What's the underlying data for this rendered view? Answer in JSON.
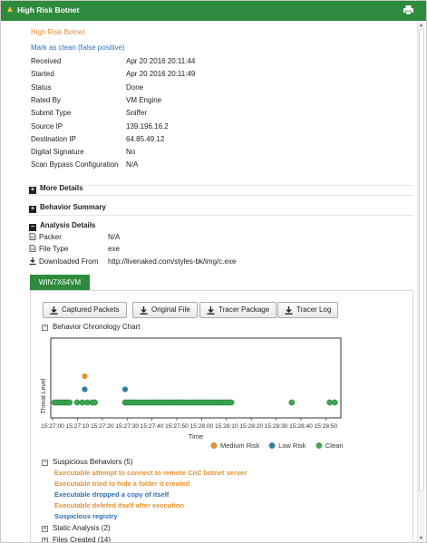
{
  "header": {
    "title": "High Risk Botnet",
    "print_icon": "print-icon",
    "warning_icon": "warning-icon"
  },
  "summary": {
    "verdict": "High Risk Botnet",
    "mark_clean": "Mark as clean (false positive)",
    "fields": [
      {
        "label": "Received",
        "value": "Apr 20 2016 20:11:44"
      },
      {
        "label": "Started",
        "value": "Apr 20 2016 20:11:49"
      },
      {
        "label": "Status",
        "value": "Done"
      },
      {
        "label": "Rated By",
        "value": "VM Engine"
      },
      {
        "label": "Submit Type",
        "value": "Sniffer"
      },
      {
        "label": "Source IP",
        "value": "139.196.16.2"
      },
      {
        "label": "Destination IP",
        "value": "64.85.49.12"
      },
      {
        "label": "Digital Signature",
        "value": "No"
      },
      {
        "label": "Scan Bypass Configuration",
        "value": "N/A"
      }
    ]
  },
  "sections": {
    "more_details": "More Details",
    "behavior_summary": "Behavior Summary",
    "analysis_details": "Analysis Details"
  },
  "analysis": {
    "packer_label": "Packer",
    "packer_value": "N/A",
    "filetype_label": "File Type",
    "filetype_value": "exe",
    "download_label": "Downloaded From",
    "download_value": "http://livenaked.com/styles-bk/img/c.exe"
  },
  "tab": {
    "label": "WIN7X64VM"
  },
  "buttons": {
    "captured": "Captured Packets",
    "original": "Original File",
    "tracer_pkg": "Tracer Package",
    "tracer_log": "Tracer Log"
  },
  "chart_section": {
    "title": "Behavior Chronology Chart"
  },
  "chart_data": {
    "type": "scatter",
    "ylabel": "Threat Level",
    "xlabel": "Time",
    "x_ticks": [
      "15:27:00",
      "15:27:10",
      "15:27:20",
      "15:27:30",
      "15:27:40",
      "15:27:50",
      "15:28:00",
      "15:28:10",
      "15:28:20",
      "15:28:30",
      "15:28:40",
      "15:28:50"
    ],
    "legend": [
      {
        "name": "Medium Risk",
        "color": "#e8912d"
      },
      {
        "name": "Low Risk",
        "color": "#2f7fa0"
      },
      {
        "name": "Clean",
        "color": "#3aa852"
      }
    ],
    "series": [
      {
        "name": "Medium Risk",
        "color": "#e8912d",
        "points": [
          [
            12,
            3
          ]
        ]
      },
      {
        "name": "Low Risk",
        "color": "#2f7fa0",
        "points": [
          [
            12,
            2
          ],
          [
            28,
            2
          ]
        ]
      },
      {
        "name": "Clean",
        "color": "#3aa852",
        "points": [
          [
            0,
            1
          ],
          [
            1,
            1
          ],
          [
            2,
            1
          ],
          [
            3,
            1
          ],
          [
            4,
            1
          ],
          [
            5,
            1
          ],
          [
            6,
            1
          ],
          [
            9,
            1
          ],
          [
            11,
            1
          ],
          [
            13,
            1
          ],
          [
            15,
            1
          ],
          [
            16,
            1
          ],
          [
            28,
            1
          ],
          [
            29,
            1
          ],
          [
            30,
            1
          ],
          [
            31,
            1
          ],
          [
            32,
            1
          ],
          [
            33,
            1
          ],
          [
            34,
            1
          ],
          [
            35,
            1
          ],
          [
            36,
            1
          ],
          [
            37,
            1
          ],
          [
            38,
            1
          ],
          [
            39,
            1
          ],
          [
            40,
            1
          ],
          [
            41,
            1
          ],
          [
            42,
            1
          ],
          [
            43,
            1
          ],
          [
            44,
            1
          ],
          [
            45,
            1
          ],
          [
            46,
            1
          ],
          [
            47,
            1
          ],
          [
            48,
            1
          ],
          [
            49,
            1
          ],
          [
            50,
            1
          ],
          [
            51,
            1
          ],
          [
            52,
            1
          ],
          [
            53,
            1
          ],
          [
            54,
            1
          ],
          [
            55,
            1
          ],
          [
            56,
            1
          ],
          [
            57,
            1
          ],
          [
            58,
            1
          ],
          [
            59,
            1
          ],
          [
            60,
            1
          ],
          [
            61,
            1
          ],
          [
            62,
            1
          ],
          [
            63,
            1
          ],
          [
            64,
            1
          ],
          [
            65,
            1
          ],
          [
            66,
            1
          ],
          [
            67,
            1
          ],
          [
            68,
            1
          ],
          [
            69,
            1
          ],
          [
            70,
            1
          ],
          [
            94,
            1
          ],
          [
            109,
            1
          ],
          [
            111,
            1
          ]
        ]
      }
    ]
  },
  "suspicious": {
    "title": "Suspicious Behaviors (5)",
    "items": [
      {
        "text": "Executable attempt to connect to remote CnC botnet server",
        "level": "medium"
      },
      {
        "text": "Executable tried to hide a folder it created",
        "level": "medium"
      },
      {
        "text": "Executable dropped a copy of itself",
        "level": "low"
      },
      {
        "text": "Executable deleted itself after execution",
        "level": "medium"
      },
      {
        "text": "Suspicious registry",
        "level": "low"
      }
    ]
  },
  "collapsed": {
    "static": "Static Analysis (2)",
    "files": "Files Created (14)"
  }
}
